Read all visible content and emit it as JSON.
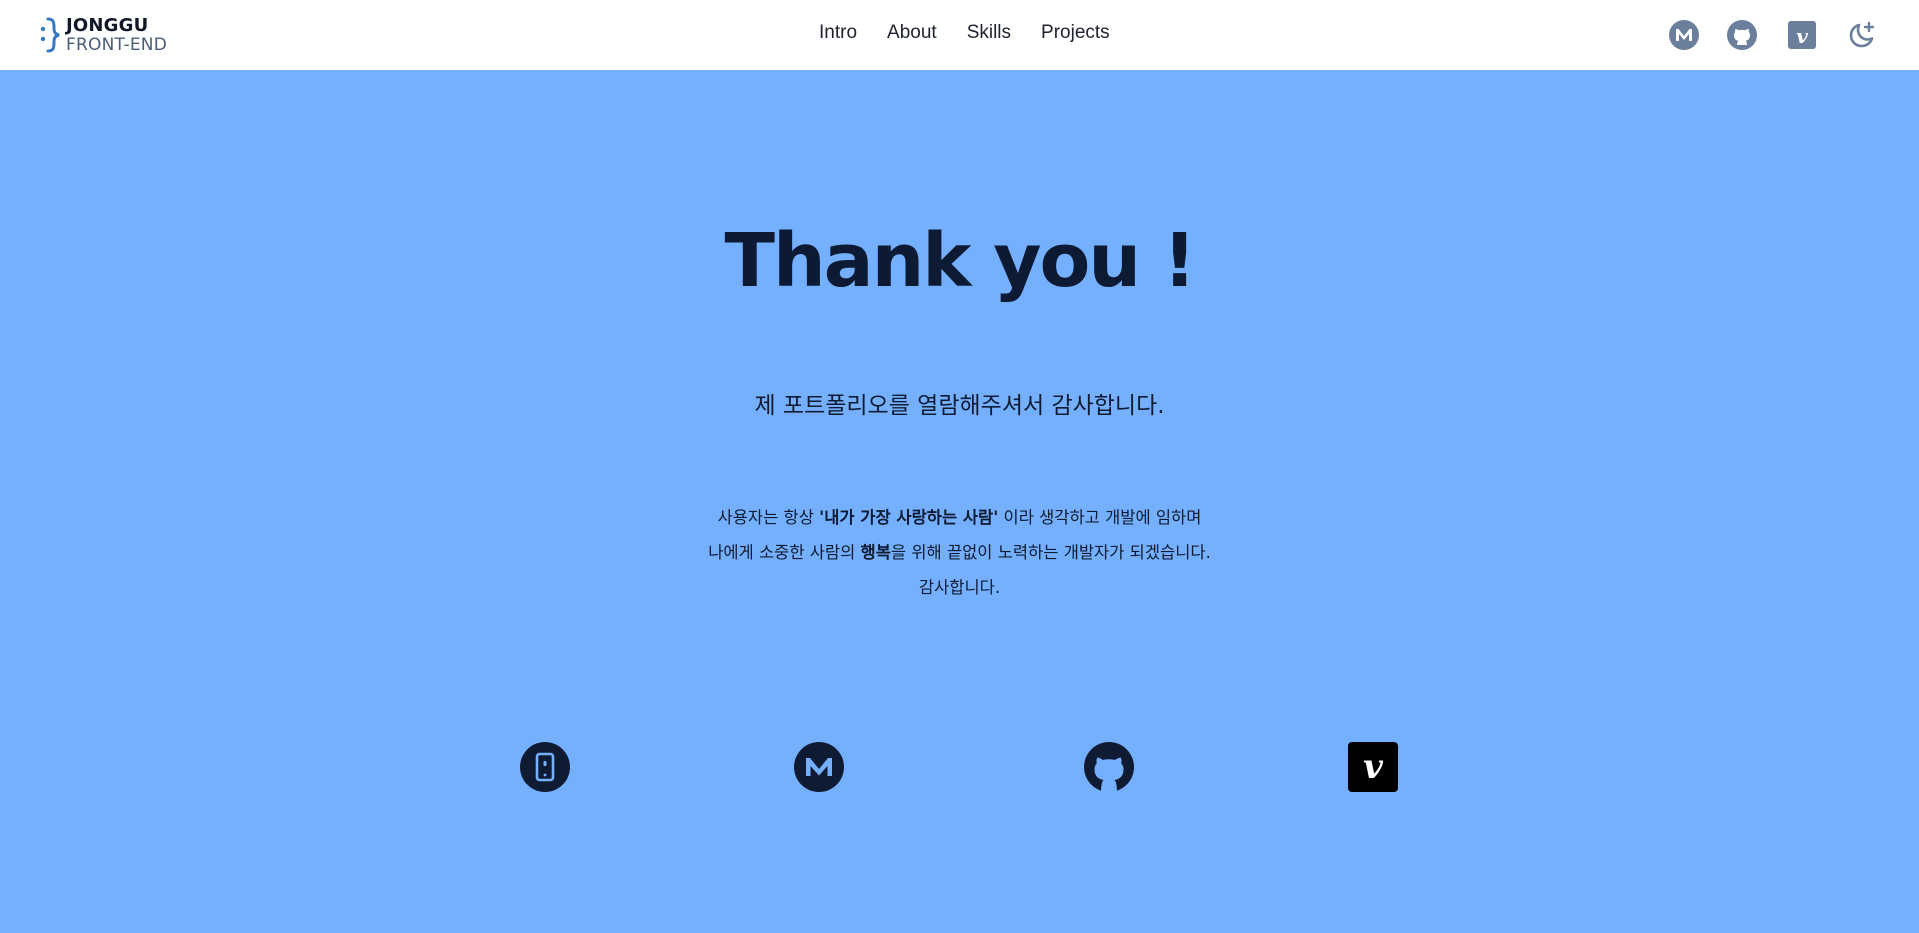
{
  "header": {
    "logo": {
      "name": "JONGGU",
      "sub": "FRONT-END"
    },
    "nav": [
      {
        "label": "Intro"
      },
      {
        "label": "About"
      },
      {
        "label": "Skills"
      },
      {
        "label": "Projects"
      }
    ],
    "icons": [
      "medium-icon",
      "github-icon",
      "vimeo-icon",
      "dark-mode-moon-icon"
    ]
  },
  "main": {
    "title": "Thank you !",
    "subtitle": "제 포트폴리오를 열람해주셔서 감사합니다.",
    "message": {
      "line1_a": "사용자는 항상 ",
      "line1_bold": "'내가 가장 사랑하는 사람'",
      "line1_b": " 이라 생각하고 개발에 임하며",
      "line2_a": "나에게 소중한 사람의 ",
      "line2_bold": "행복",
      "line2_b": "을 위해 끝없이 노력하는 개발자가 되겠습니다.",
      "line3": "감사합니다."
    }
  },
  "contacts": [
    "phone-icon",
    "medium-icon",
    "github-icon",
    "vimeo-icon"
  ],
  "colors": {
    "background": "#74b0fe",
    "header_bg": "#ffffff",
    "header_icon": "#6b7f9c",
    "dark": "#0f1b33",
    "logo_accent": "#3778c2"
  }
}
